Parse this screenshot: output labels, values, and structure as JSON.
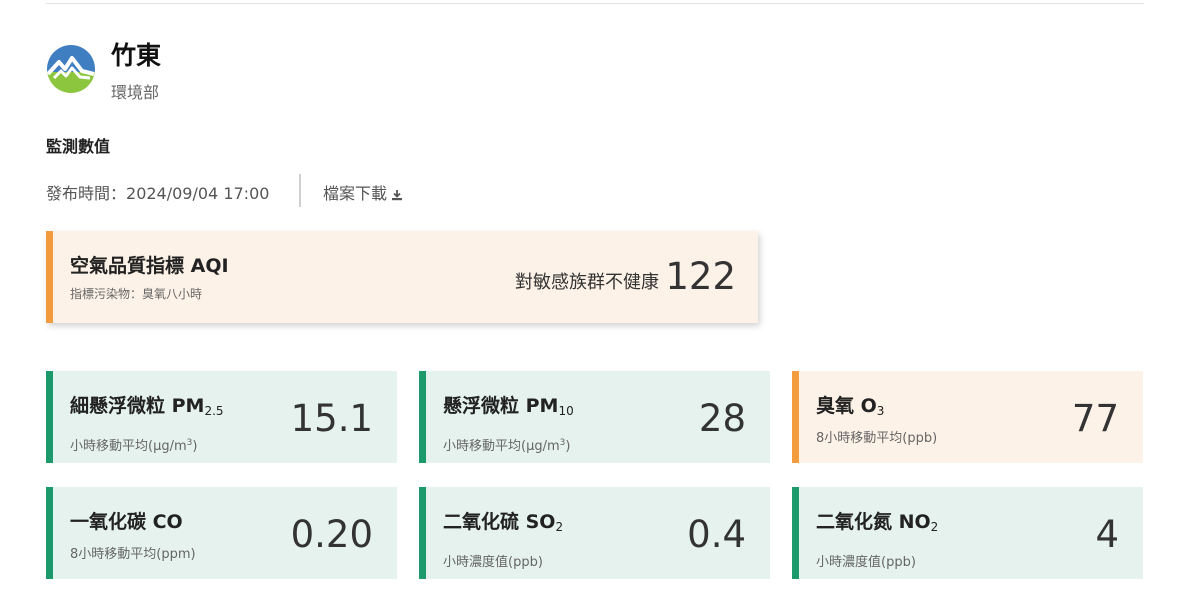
{
  "station": {
    "name": "竹東",
    "org": "環境部"
  },
  "section_title": "監測數值",
  "publish": {
    "label": "發布時間：",
    "time": "2024/09/04 17:00"
  },
  "download": {
    "label": "檔案下載",
    "icon": "download-icon"
  },
  "aqi": {
    "title": "空氣品質指標 AQI",
    "pollutant_label": "指標污染物：",
    "pollutant": "臭氧八小時",
    "status": "對敏感族群不健康",
    "value": "122",
    "color": "#f39c3d"
  },
  "colors": {
    "good": "#1c9a6c",
    "good_bg": "#e5f2ee",
    "moderate": "#f39c3d",
    "moderate_bg": "#fdf2e7"
  },
  "pollutants": [
    {
      "name": "細懸浮微粒 PM",
      "sub": "2.5",
      "desc": "小時移動平均(μg/m",
      "desc_sup": "3",
      "desc_end": ")",
      "value": "15.1",
      "level": "good"
    },
    {
      "name": "懸浮微粒 PM",
      "sub": "10",
      "desc": "小時移動平均(μg/m",
      "desc_sup": "3",
      "desc_end": ")",
      "value": "28",
      "level": "good"
    },
    {
      "name": "臭氧 O",
      "sub": "3",
      "desc": "8小時移動平均(ppb)",
      "value": "77",
      "level": "moderate"
    },
    {
      "name": "一氧化碳 CO",
      "desc": "8小時移動平均(ppm)",
      "value": "0.20",
      "level": "good"
    },
    {
      "name": "二氧化硫 SO",
      "sub": "2",
      "desc": "小時濃度值(ppb)",
      "value": "0.4",
      "level": "good"
    },
    {
      "name": "二氧化氮 NO",
      "sub": "2",
      "desc": "小時濃度值(ppb)",
      "value": "4",
      "level": "good"
    }
  ]
}
